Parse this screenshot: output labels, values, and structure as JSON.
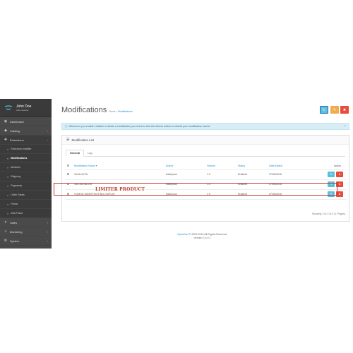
{
  "profile": {
    "name": "John Doe",
    "role": "Administrator"
  },
  "sidebar": {
    "items": [
      {
        "label": "Dashboard",
        "icon": "dashboard-icon",
        "glyph": "◉",
        "chev": ""
      },
      {
        "label": "Catalog",
        "icon": "tag-icon",
        "glyph": "◆",
        "chev": "›"
      },
      {
        "label": "Extensions",
        "icon": "puzzle-icon",
        "glyph": "✚",
        "chev": "›"
      }
    ],
    "sub": [
      "Extension Installer",
      "Modifications",
      "Modules",
      "Shipping",
      "Payments",
      "Order Totals",
      "Feeds",
      "Anti-Fraud"
    ],
    "items2": [
      {
        "label": "Sales",
        "icon": "cart-icon",
        "glyph": "✦",
        "chev": "›"
      },
      {
        "label": "Marketing",
        "icon": "share-icon",
        "glyph": "✧",
        "chev": "›"
      },
      {
        "label": "System",
        "icon": "gear-icon",
        "glyph": "⚙",
        "chev": "›"
      }
    ]
  },
  "header": {
    "title": "Modifications",
    "breadcrumb": [
      "Home",
      "Modifications"
    ]
  },
  "alert": "Whenever you enable / disable or delete a modification you need to click the refresh button to rebuild your modification cache!",
  "panel": {
    "title": "Modification List",
    "tabs": [
      "General",
      "Log"
    ]
  },
  "table": {
    "headers": [
      "Modification Name",
      "Author",
      "Version",
      "Status",
      "Date Added",
      "Action"
    ],
    "rows": [
      [
        "1M ALAYTA",
        "bdahyous",
        "1.0",
        "Enabled",
        "07/06/2016"
      ],
      [
        "1M LIMITADOR",
        "bdahyous",
        "1.0",
        "Enabled",
        "07/06/2016"
      ],
      [
        "VQMOD WIDER EDITING DISPLAY",
        "bdahyous",
        "1.0",
        "Enabled",
        "07/06/2016"
      ]
    ],
    "showing": "Showing 1 to 3 of 3 (1 Pages)"
  },
  "annotation": "LIMITER PRODUCT",
  "footer": {
    "brand": "OpenCart",
    "copy": "© 2009-2016 All Rights Reserved.",
    "version": "Version 2.3.0.1"
  },
  "colors": {
    "sidebar": "#4a4a4a",
    "accent": "#1e91cf",
    "highlight": "#c0392b"
  }
}
